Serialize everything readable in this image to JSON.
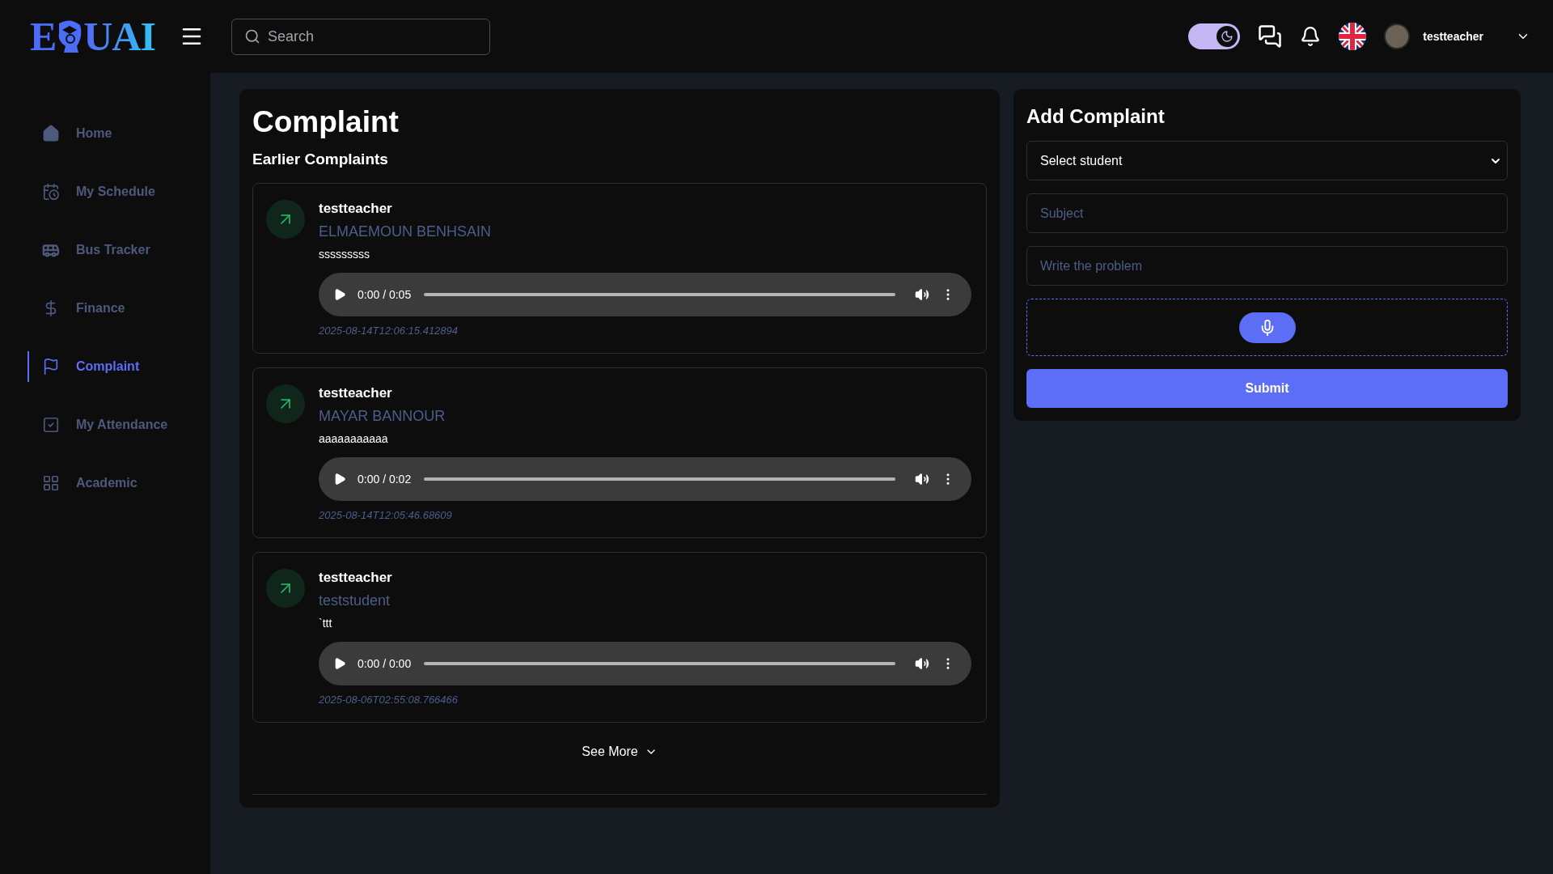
{
  "header": {
    "logo": {
      "before": "E",
      "after": "UAI"
    },
    "search": {
      "placeholder": "Search"
    },
    "theme_toggle": {
      "on": true
    },
    "user": {
      "name": "testteacher"
    }
  },
  "sidebar": {
    "items": [
      {
        "label": "Home",
        "selected": false
      },
      {
        "label": "My Schedule",
        "selected": false
      },
      {
        "label": "Bus Tracker",
        "selected": false
      },
      {
        "label": "Finance",
        "selected": false
      },
      {
        "label": "Complaint",
        "selected": true
      },
      {
        "label": "My Attendance",
        "selected": false
      },
      {
        "label": "Academic",
        "selected": false
      }
    ]
  },
  "complaints": {
    "title": "Complaint",
    "subtitle": "Earlier Complaints",
    "items": [
      {
        "author": "testteacher",
        "recipient": "ELMAEMOUN BENHSAIN",
        "text": "sssssssss",
        "audio_time": "0:00 / 0:05",
        "timestamp": "2025-08-14T12:06:15.412894"
      },
      {
        "author": "testteacher",
        "recipient": "MAYAR BANNOUR",
        "text": "aaaaaaaaaaa",
        "audio_time": "0:00 / 0:02",
        "timestamp": "2025-08-14T12:05:46.68609"
      },
      {
        "author": "testteacher",
        "recipient": "teststudent",
        "text": "`ttt",
        "audio_time": "0:00 / 0:00",
        "timestamp": "2025-08-06T02:55:08.766466"
      }
    ],
    "see_more": "See More"
  },
  "add_complaint": {
    "title": "Add Complaint",
    "student_select": "Select student",
    "subject": {
      "placeholder": "Subject"
    },
    "problem": {
      "placeholder": "Write the problem"
    },
    "submit": "Submit"
  }
}
